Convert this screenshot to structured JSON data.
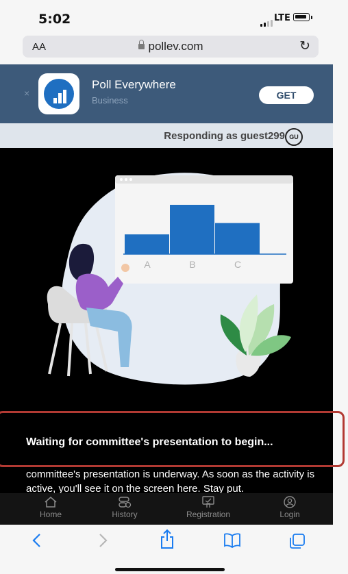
{
  "status_bar": {
    "time": "5:02",
    "network": "LTE"
  },
  "url_bar": {
    "text_size_label": "AA",
    "domain": "pollev.com"
  },
  "app_banner": {
    "close_symbol": "×",
    "app_name": "Poll Everywhere",
    "category": "Business",
    "get_label": "GET"
  },
  "responding": {
    "text": "Responding as guest299",
    "badge": "GU"
  },
  "illustration": {
    "bar_labels": [
      "A",
      "B",
      "C"
    ],
    "bar_values": [
      0.4,
      1.0,
      0.63
    ],
    "bar_color": "#1f6fc1"
  },
  "main": {
    "waiting_title": "Waiting for committee's presentation to begin...",
    "description": "committee's presentation is underway. As soon as the activity is active, you'll see it on the screen here. Stay put."
  },
  "tab_bar": {
    "items": [
      {
        "label": "Home",
        "icon": "home-icon"
      },
      {
        "label": "History",
        "icon": "history-icon"
      },
      {
        "label": "Registration",
        "icon": "registration-icon"
      },
      {
        "label": "Login",
        "icon": "login-icon"
      }
    ]
  },
  "safari_toolbar": {
    "icons": [
      "back-icon",
      "forward-icon",
      "share-icon",
      "bookmarks-icon",
      "tabs-icon"
    ]
  },
  "colors": {
    "accent": "#1f6fc1",
    "banner": "#3d5a7a",
    "annotation": "#b23a33"
  }
}
